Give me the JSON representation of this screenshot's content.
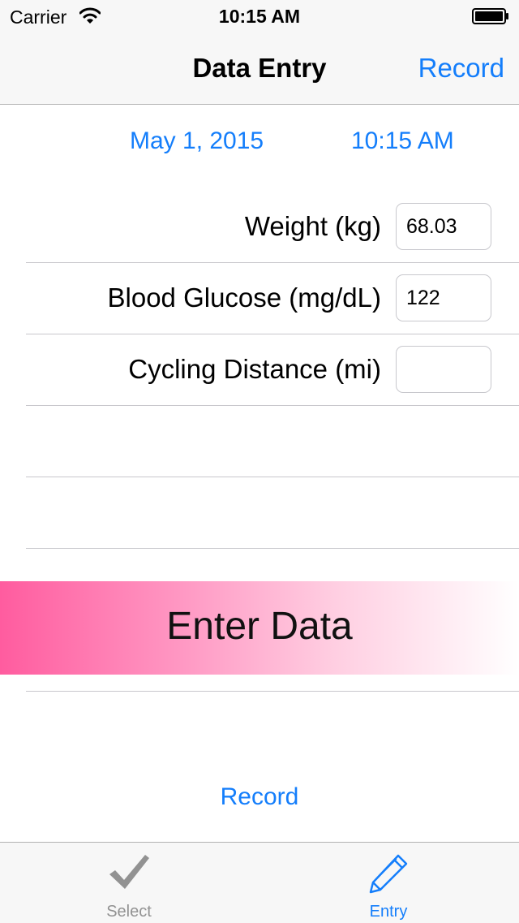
{
  "status_bar": {
    "carrier": "Carrier",
    "time": "10:15 AM",
    "icons": [
      "wifi-icon",
      "battery-icon"
    ]
  },
  "nav_bar": {
    "title": "Data Entry",
    "right_button": "Record"
  },
  "datetime": {
    "date": "May 1, 2015",
    "time": "10:15 AM"
  },
  "fields": [
    {
      "label": "Weight (kg)",
      "value": "68.03"
    },
    {
      "label": "Blood Glucose (mg/dL)",
      "value": "122"
    },
    {
      "label": "Cycling Distance (mi)",
      "value": ""
    }
  ],
  "enter_banner": {
    "text": "Enter Data",
    "colors": [
      "#ff5c9f",
      "#ffffff"
    ]
  },
  "record_button": "Record",
  "tab_bar": {
    "tabs": [
      {
        "label": "Select",
        "icon": "checkmark-icon",
        "selected": false
      },
      {
        "label": "Entry",
        "icon": "pencil-icon",
        "selected": true
      }
    ]
  },
  "colors": {
    "accent": "#147efb",
    "inactive": "#929292",
    "bar_background": "#f7f7f7"
  }
}
